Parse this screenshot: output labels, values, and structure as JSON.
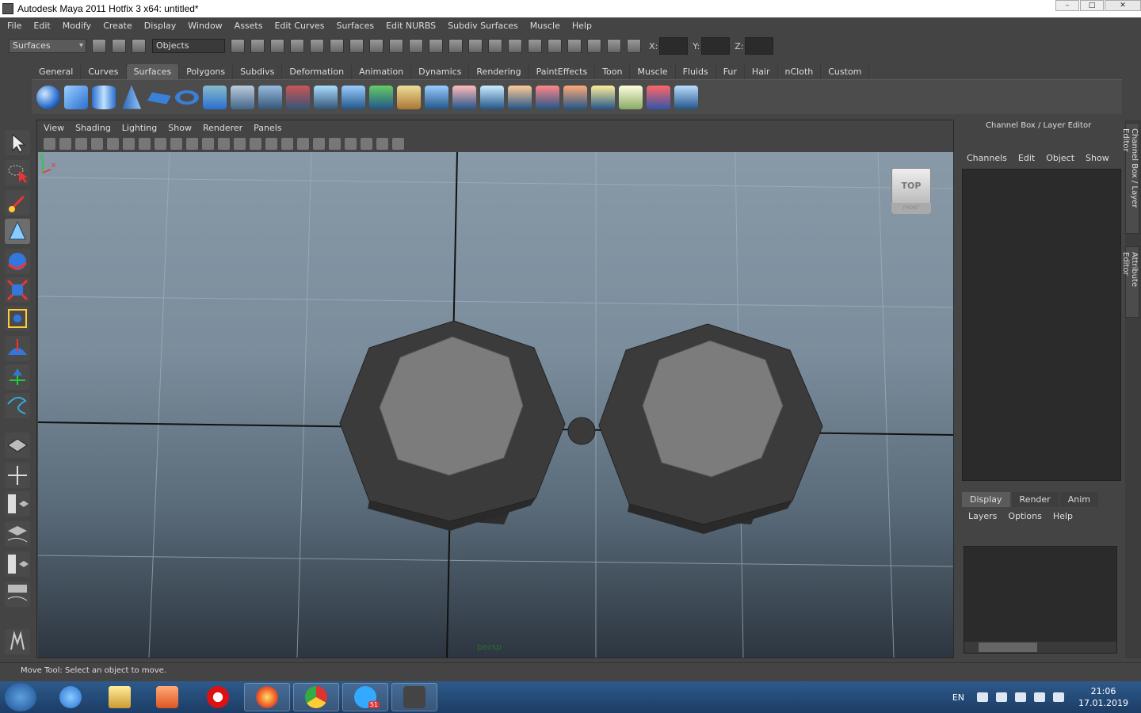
{
  "window": {
    "title": "Autodesk Maya 2011 Hotfix 3 x64: untitled*",
    "min": "–",
    "max": "□",
    "close": "✕"
  },
  "menubar": [
    "File",
    "Edit",
    "Modify",
    "Create",
    "Display",
    "Window",
    "Assets",
    "Edit Curves",
    "Surfaces",
    "Edit NURBS",
    "Subdiv Surfaces",
    "Muscle",
    "Help"
  ],
  "statusline": {
    "menuset": "Surfaces",
    "selection_mode": "Objects",
    "x_label": "X:",
    "y_label": "Y:",
    "z_label": "Z:"
  },
  "shelf": {
    "tabs": [
      "General",
      "Curves",
      "Surfaces",
      "Polygons",
      "Subdivs",
      "Deformation",
      "Animation",
      "Dynamics",
      "Rendering",
      "PaintEffects",
      "Toon",
      "Muscle",
      "Fluids",
      "Fur",
      "Hair",
      "nCloth",
      "Custom"
    ],
    "active_tab": "Surfaces"
  },
  "viewport": {
    "menu": [
      "View",
      "Shading",
      "Lighting",
      "Show",
      "Renderer",
      "Panels"
    ],
    "camera_label": "persp",
    "viewcube_top": "TOP",
    "viewcube_front": "FRONT",
    "axis_y": "y",
    "axis_x": "x"
  },
  "channel_box": {
    "title": "Channel Box / Layer Editor",
    "menu": [
      "Channels",
      "Edit",
      "Object",
      "Show"
    ],
    "layer_tabs": [
      "Display",
      "Render",
      "Anim"
    ],
    "active_layer_tab": "Display",
    "layer_menu": [
      "Layers",
      "Options",
      "Help"
    ]
  },
  "side_tabs": [
    "Channel Box / Layer Editor",
    "Attribute Editor"
  ],
  "helpline": {
    "text": "Move Tool: Select an object to move."
  },
  "taskbar": {
    "lang": "EN",
    "time": "21:06",
    "date": "17.01.2019",
    "telegram_badge": "51"
  },
  "colors": {
    "accent": "#5b5b5b",
    "viewport_top": "#8899a8",
    "viewport_bottom": "#2d3640",
    "taskbar": "#1c3d66"
  }
}
